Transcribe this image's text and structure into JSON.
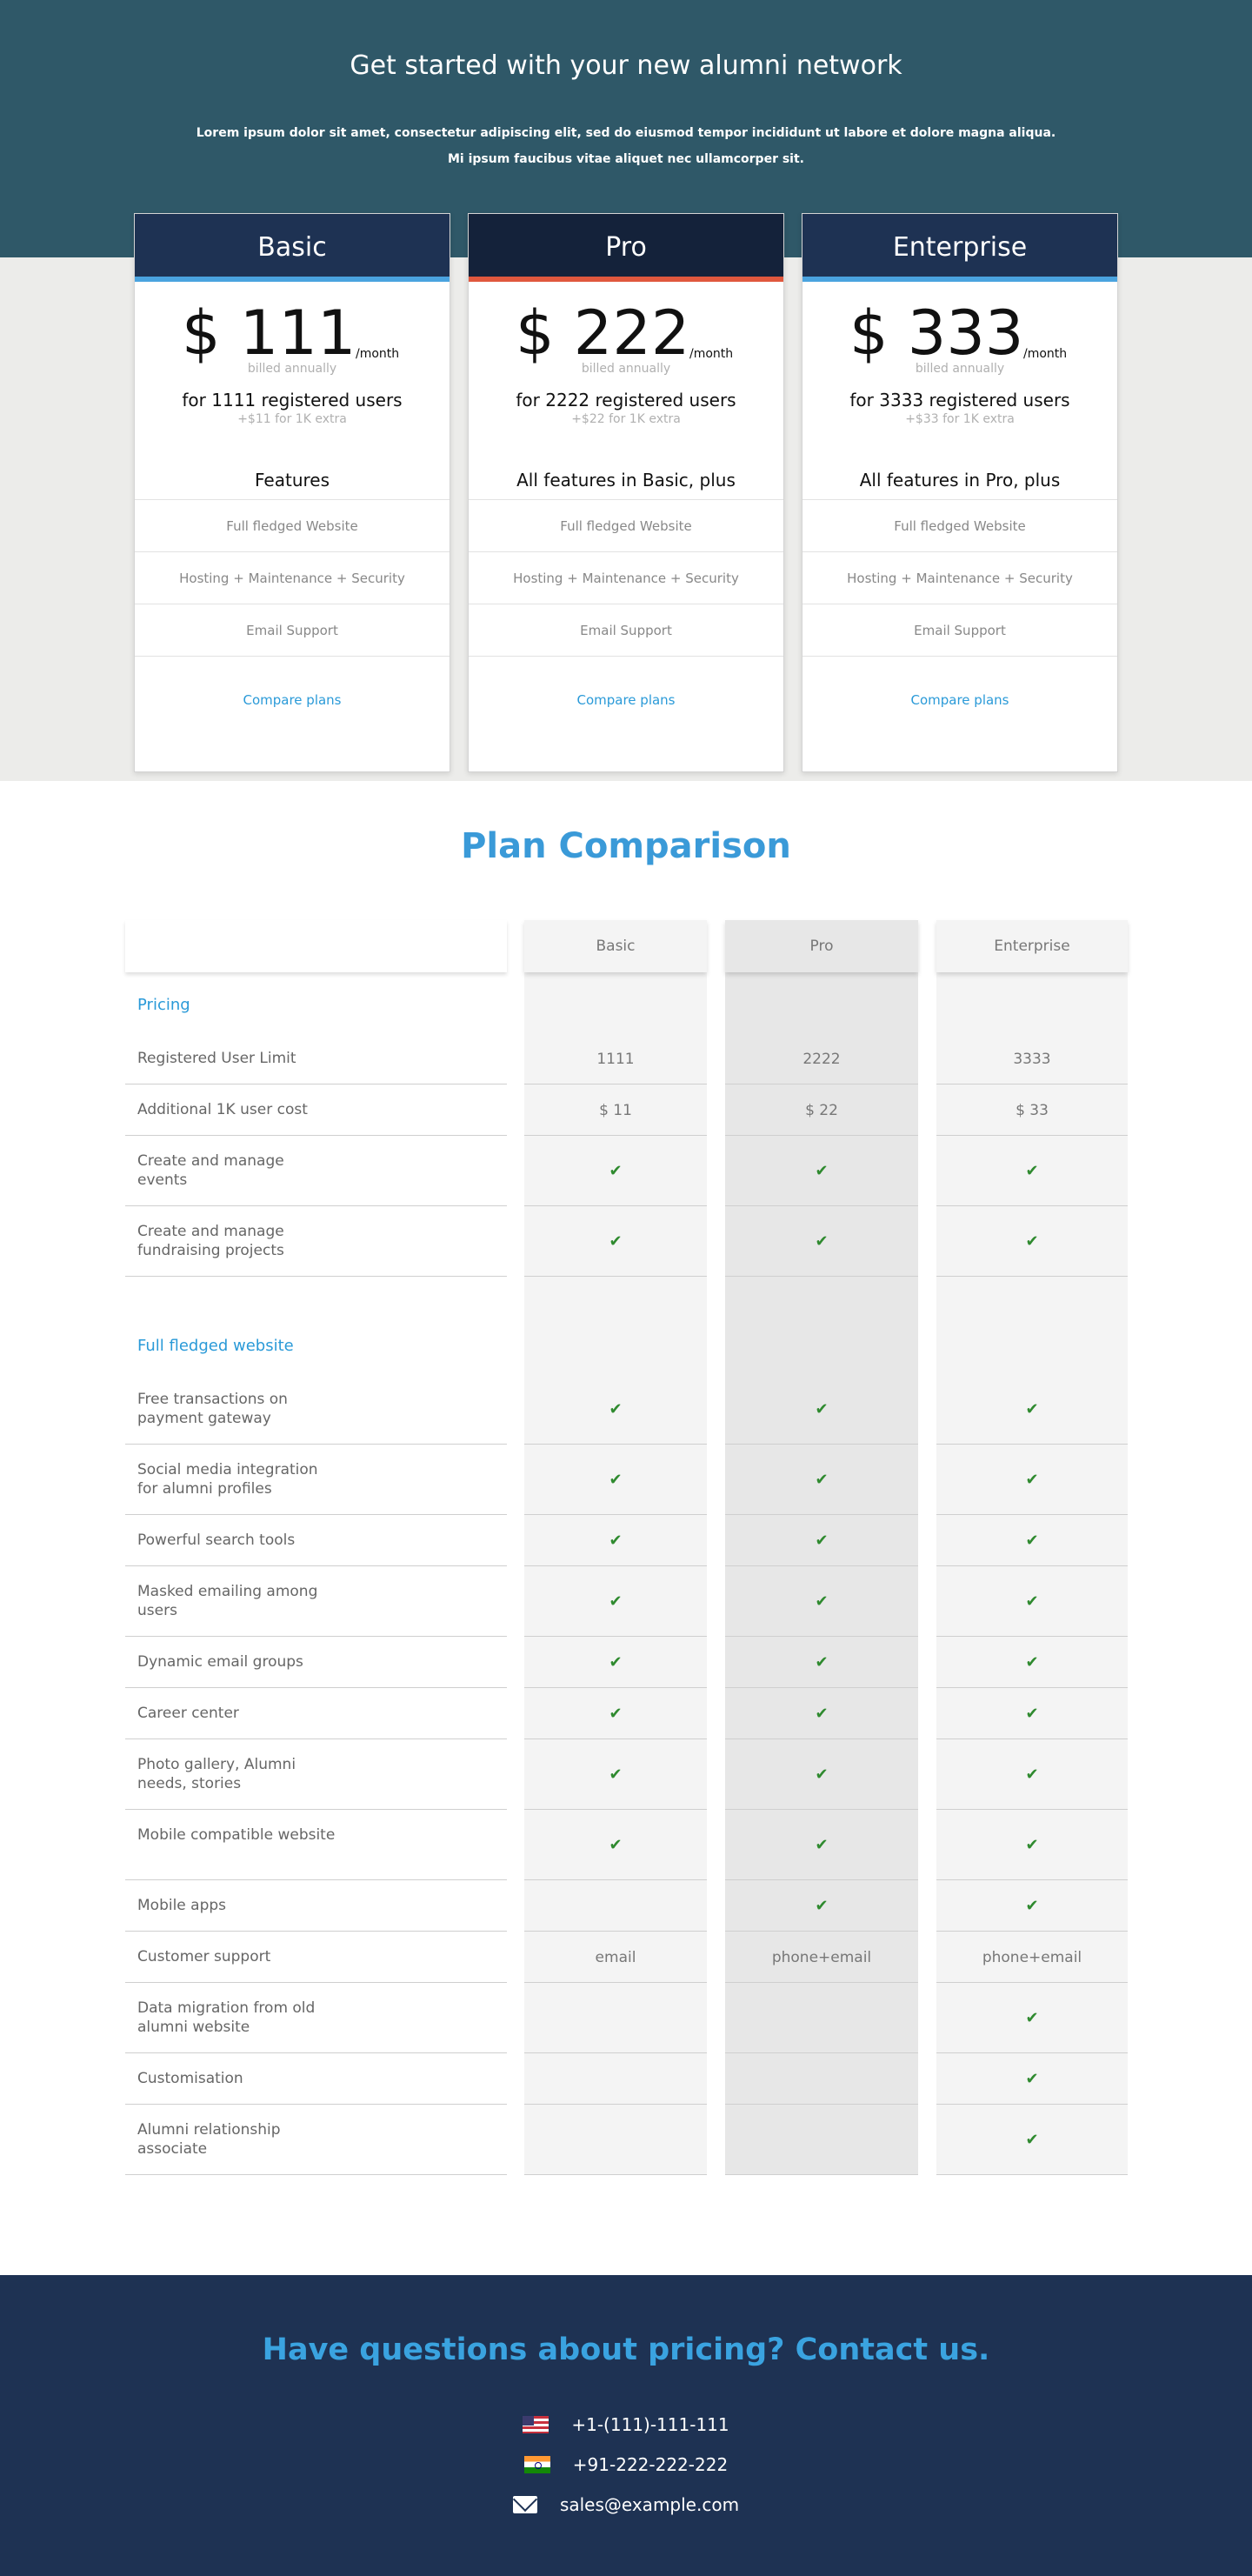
{
  "hero": {
    "title": "Get started with your new alumni network",
    "subtitle_line1": "Lorem ipsum dolor sit amet, consectetur adipiscing elit, sed do eiusmod tempor incididunt ut labore et dolore magna aliqua.",
    "subtitle_line2": "Mi ipsum faucibus vitae aliquet nec ullamcorper sit."
  },
  "plans": [
    {
      "name": "Basic",
      "price": "$ 111",
      "period": "/month",
      "billing": "billed annually",
      "users": "for 1111 registered users",
      "extra": "+$11 for 1K extra",
      "features_title": "Features",
      "features": [
        "Full fledged Website",
        "Hosting + Maintenance + Security",
        "Email Support"
      ],
      "cta": "Compare plans"
    },
    {
      "name": "Pro",
      "price": "$ 222",
      "period": "/month",
      "billing": "billed annually",
      "users": "for 2222 registered users",
      "extra": "+$22 for 1K extra",
      "features_title": "All features in Basic, plus",
      "features": [
        "Full fledged Website",
        "Hosting + Maintenance + Security",
        "Email Support"
      ],
      "cta": "Compare plans"
    },
    {
      "name": "Enterprise",
      "price": "$ 333",
      "period": "/month",
      "billing": "billed annually",
      "users": "for 3333 registered users",
      "extra": "+$33 for 1K extra",
      "features_title": "All features in Pro, plus",
      "features": [
        "Full fledged Website",
        "Hosting + Maintenance + Security",
        "Email Support"
      ],
      "cta": "Compare plans"
    }
  ],
  "comparison": {
    "title": "Plan Comparison",
    "columns": [
      "Basic",
      "Pro",
      "Enterprise"
    ],
    "sections": [
      {
        "label": "Pricing",
        "rows": [
          {
            "label": "Registered User Limit",
            "values": [
              "1111",
              "2222",
              "3333"
            ]
          },
          {
            "label": "Additional 1K user cost",
            "values": [
              "$ 11",
              "$ 22",
              "$ 33"
            ]
          },
          {
            "label": "Create and manage events",
            "values": [
              "check",
              "check",
              "check"
            ]
          },
          {
            "label": "Create and manage fundraising projects",
            "values": [
              "check",
              "check",
              "check"
            ]
          }
        ]
      },
      {
        "label": "Full fledged website",
        "rows": [
          {
            "label": "Free transactions on payment gateway",
            "values": [
              "check",
              "check",
              "check"
            ]
          },
          {
            "label": "Social media integration for alumni profiles",
            "values": [
              "check",
              "check",
              "check"
            ]
          },
          {
            "label": "Powerful search tools",
            "values": [
              "check",
              "check",
              "check"
            ]
          },
          {
            "label": "Masked emailing among users",
            "values": [
              "check",
              "check",
              "check"
            ]
          },
          {
            "label": "Dynamic email groups",
            "values": [
              "check",
              "check",
              "check"
            ]
          },
          {
            "label": "Career center",
            "values": [
              "check",
              "check",
              "check"
            ]
          },
          {
            "label": "Photo gallery, Alumni needs, stories",
            "values": [
              "check",
              "check",
              "check"
            ]
          },
          {
            "label": "Mobile compatible website",
            "values": [
              "check",
              "check",
              "check"
            ]
          },
          {
            "label": "Mobile apps",
            "values": [
              "",
              "check",
              "check"
            ]
          },
          {
            "label": "Customer support",
            "values": [
              "email",
              "phone+email",
              "phone+email"
            ]
          },
          {
            "label": "Data migration from old alumni website",
            "values": [
              "",
              "",
              "check"
            ]
          },
          {
            "label": "Customisation",
            "values": [
              "",
              "",
              "check"
            ]
          },
          {
            "label": "Alumni relationship associate",
            "values": [
              "",
              "",
              "check"
            ]
          }
        ]
      }
    ]
  },
  "footer": {
    "title": "Have questions about pricing? Contact us.",
    "contacts": [
      {
        "icon": "us-flag-icon",
        "text": "+1-(111)-111-111"
      },
      {
        "icon": "india-flag-icon",
        "text": "+91-222-222-222"
      },
      {
        "icon": "mail-icon",
        "text": "sales@example.com"
      }
    ]
  },
  "colors": {
    "hero_bg": "#2f5868",
    "card_header": "#1e3253",
    "accent_blue": "#3a9ad8",
    "accent_orange": "#e0583e",
    "check_green": "#2f8a2f"
  }
}
